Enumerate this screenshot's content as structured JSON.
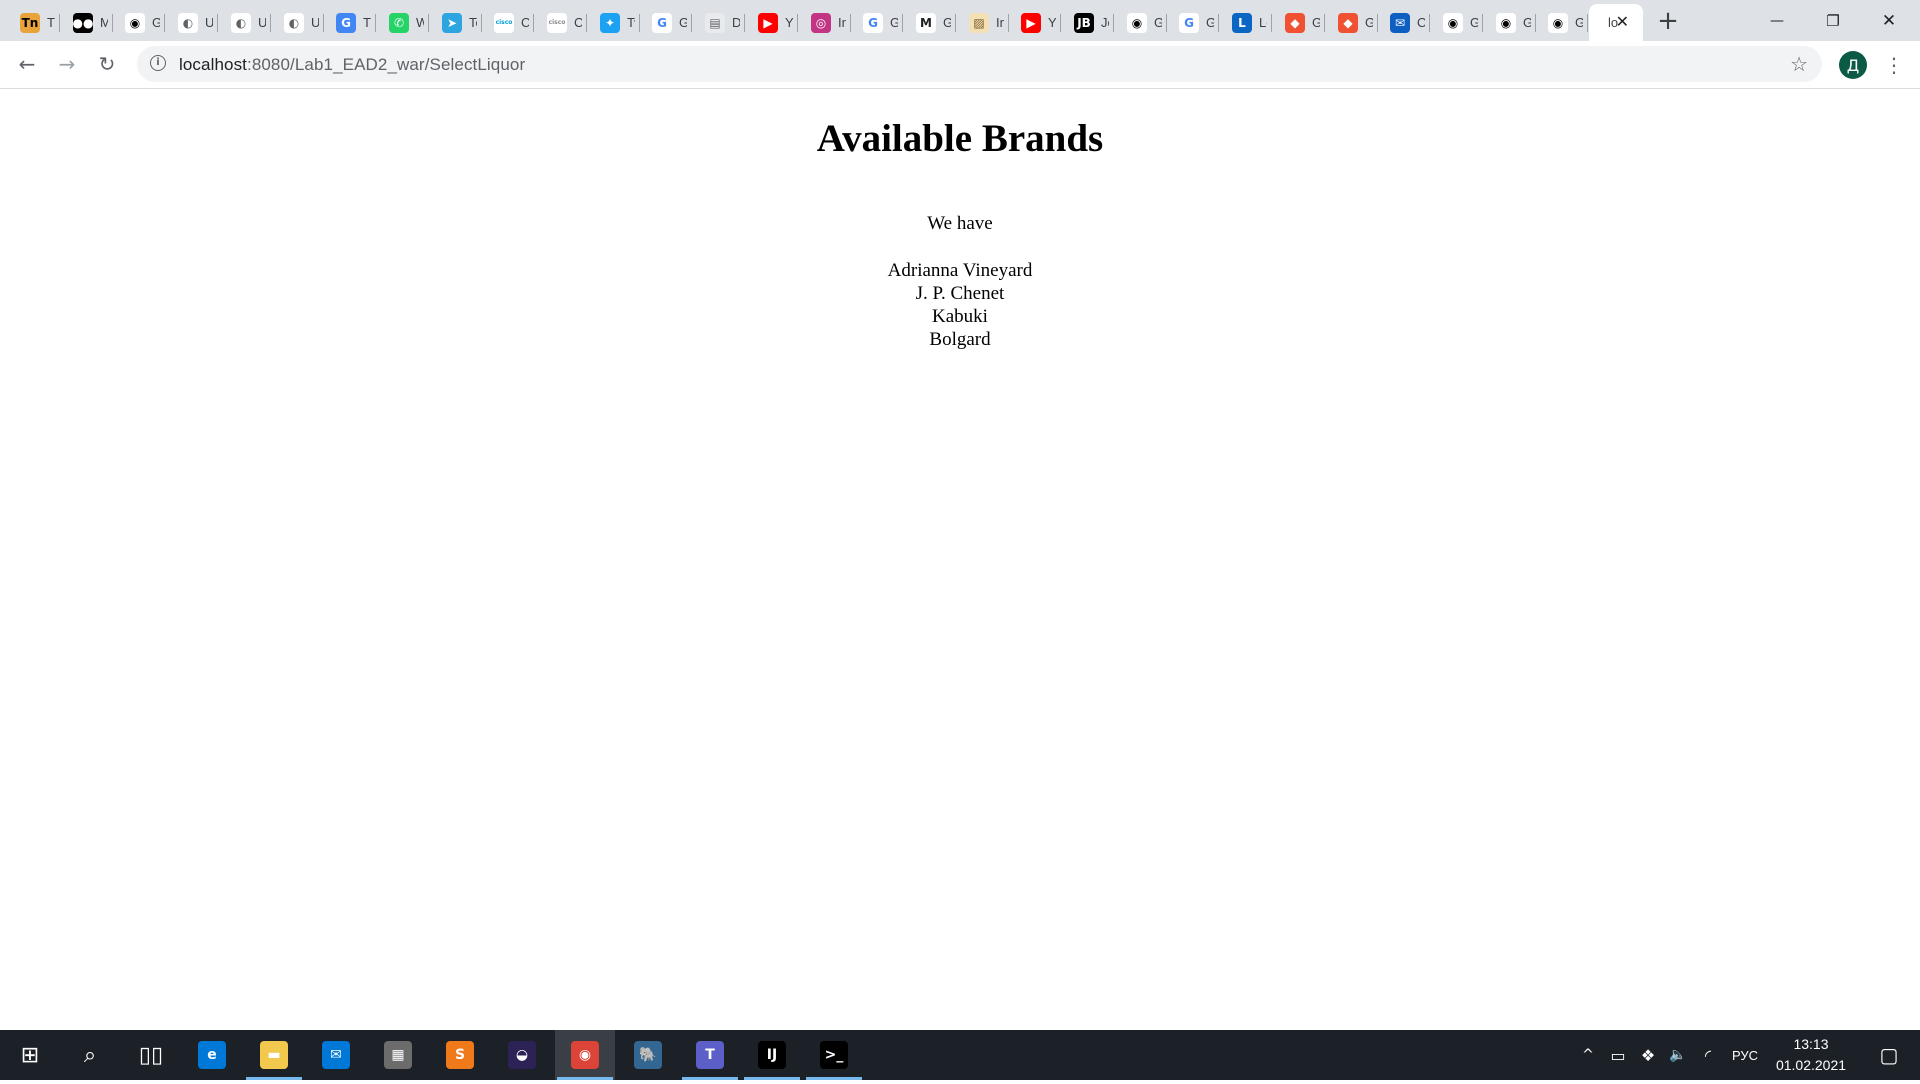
{
  "browser": {
    "tabs": [
      {
        "icon": "tn-icon",
        "title": "TN",
        "glyph": "Tn",
        "color": "#e8a33a",
        "text_color": "#000000"
      },
      {
        "icon": "medium-icon",
        "title": "Medium",
        "glyph": "●●",
        "color": "#000000",
        "text_color": "#ffffff"
      },
      {
        "icon": "github-icon",
        "title": "GitHub",
        "glyph": "◉",
        "color": "#ffffff",
        "text_color": "#000000"
      },
      {
        "icon": "globe-icon",
        "title": "Untitled",
        "glyph": "◐",
        "color": "#ffffff",
        "text_color": "#5f6368"
      },
      {
        "icon": "globe-icon",
        "title": "Untitled",
        "glyph": "◐",
        "color": "#ffffff",
        "text_color": "#5f6368"
      },
      {
        "icon": "globe-icon",
        "title": "Untitled",
        "glyph": "◐",
        "color": "#ffffff",
        "text_color": "#5f6368"
      },
      {
        "icon": "google-translate-icon",
        "title": "Translate",
        "glyph": "G",
        "color": "#4285f4",
        "text_color": "#ffffff"
      },
      {
        "icon": "whatsapp-icon",
        "title": "WhatsApp",
        "glyph": "✆",
        "color": "#25d366",
        "text_color": "#ffffff"
      },
      {
        "icon": "telegram-icon",
        "title": "Telegram",
        "glyph": "➤",
        "color": "#2ca5e0",
        "text_color": "#ffffff"
      },
      {
        "icon": "cisco-icon",
        "title": "Cisco",
        "glyph": "cisco",
        "color": "#ffffff",
        "text_color": "#049fd9"
      },
      {
        "icon": "cisco-icon",
        "title": "Cisco",
        "glyph": "cisco",
        "color": "#ffffff",
        "text_color": "#8a8a8a"
      },
      {
        "icon": "twitter-icon",
        "title": "Twitter",
        "glyph": "✦",
        "color": "#1da1f2",
        "text_color": "#ffffff"
      },
      {
        "icon": "google-icon",
        "title": "Google",
        "glyph": "G",
        "color": "#ffffff",
        "text_color": "#4285f4"
      },
      {
        "icon": "docs-icon",
        "title": "Docs",
        "glyph": "▤",
        "color": "#e8eaed",
        "text_color": "#5f6368"
      },
      {
        "icon": "youtube-icon",
        "title": "YouTube",
        "glyph": "▶",
        "color": "#ff0000",
        "text_color": "#ffffff"
      },
      {
        "icon": "instagram-icon",
        "title": "Instagram",
        "glyph": "◎",
        "color": "#c13584",
        "text_color": "#ffffff"
      },
      {
        "icon": "google-icon",
        "title": "Google",
        "glyph": "G",
        "color": "#ffffff",
        "text_color": "#4285f4"
      },
      {
        "icon": "gmail-icon",
        "title": "Gmail",
        "glyph": "M",
        "color": "#ffffff",
        "text_color": "#202124"
      },
      {
        "icon": "image-icon",
        "title": "Image",
        "glyph": "▨",
        "color": "#f3e0b5",
        "text_color": "#7a5a2a"
      },
      {
        "icon": "youtube-icon",
        "title": "YouTube",
        "glyph": "▶",
        "color": "#ff0000",
        "text_color": "#ffffff"
      },
      {
        "icon": "jetbrains-icon",
        "title": "JetBrains",
        "glyph": "JB",
        "color": "#000000",
        "text_color": "#ffffff"
      },
      {
        "icon": "github-icon",
        "title": "GitHub",
        "glyph": "◉",
        "color": "#ffffff",
        "text_color": "#000000"
      },
      {
        "icon": "google-icon",
        "title": "Google",
        "glyph": "G",
        "color": "#ffffff",
        "text_color": "#4285f4"
      },
      {
        "icon": "linkedin-learning-icon",
        "title": "Learning",
        "glyph": "L",
        "color": "#0a66c2",
        "text_color": "#ffffff"
      },
      {
        "icon": "git-icon",
        "title": "Git",
        "glyph": "◆",
        "color": "#f05133",
        "text_color": "#ffffff"
      },
      {
        "icon": "git-icon",
        "title": "Git",
        "glyph": "◆",
        "color": "#f05133",
        "text_color": "#ffffff"
      },
      {
        "icon": "outlook-icon",
        "title": "Outlook",
        "glyph": "✉",
        "color": "#0f5fc2",
        "text_color": "#ffffff"
      },
      {
        "icon": "github-icon",
        "title": "GitHub",
        "glyph": "◉",
        "color": "#ffffff",
        "text_color": "#000000"
      },
      {
        "icon": "github-icon",
        "title": "GitHub",
        "glyph": "◉",
        "color": "#ffffff",
        "text_color": "#000000"
      },
      {
        "icon": "github-icon",
        "title": "GitHub",
        "glyph": "◉",
        "color": "#ffffff",
        "text_color": "#000000"
      }
    ],
    "active_tab": {
      "title": "lo",
      "close_glyph": "✕"
    },
    "new_tab_glyph": "+",
    "window_controls": {
      "minimize": "—",
      "restore": "❐",
      "close": "✕"
    },
    "toolbar": {
      "back_glyph": "←",
      "forward_glyph": "→",
      "reload_glyph": "↻",
      "info_glyph": "i",
      "url_host": "localhost",
      "url_path": ":8080/Lab1_EAD2_war/SelectLiquor",
      "star_glyph": "☆",
      "profile_initial": "Д",
      "menu_glyph": "⋮"
    }
  },
  "page": {
    "heading": "Available Brands",
    "intro": "We have",
    "brands": [
      "Adrianna Vineyard",
      "J. P. Chenet",
      "Kabuki",
      "Bolgard"
    ]
  },
  "taskbar": {
    "pinned": [
      {
        "icon": "windows-start-icon",
        "glyph": "⊞",
        "color": "transparent",
        "running": false,
        "active": false
      },
      {
        "icon": "search-icon",
        "glyph": "⌕",
        "color": "transparent",
        "running": false,
        "active": false
      },
      {
        "icon": "task-view-icon",
        "glyph": "▯▯",
        "color": "transparent",
        "running": false,
        "active": false
      },
      {
        "icon": "edge-icon",
        "glyph": "e",
        "color": "#0078d7",
        "running": false,
        "active": false
      },
      {
        "icon": "file-explorer-icon",
        "glyph": "▬",
        "color": "#f2c94c",
        "running": true,
        "active": false
      },
      {
        "icon": "mail-icon",
        "glyph": "✉",
        "color": "#0078d7",
        "running": false,
        "active": false
      },
      {
        "icon": "store-icon",
        "glyph": "▦",
        "color": "#6c6c6c",
        "running": false,
        "active": false
      },
      {
        "icon": "sublime-text-icon",
        "glyph": "S",
        "color": "#f07a1a",
        "running": false,
        "active": false
      },
      {
        "icon": "eclipse-icon",
        "glyph": "◒",
        "color": "#2c2255",
        "running": false,
        "active": false
      },
      {
        "icon": "chrome-icon",
        "glyph": "◉",
        "color": "#db4437",
        "running": true,
        "active": true
      },
      {
        "icon": "postgresql-icon",
        "glyph": "🐘",
        "color": "#336791",
        "running": false,
        "active": false
      },
      {
        "icon": "teams-icon",
        "glyph": "T",
        "color": "#5b5fc7",
        "running": true,
        "active": false
      },
      {
        "icon": "intellij-icon",
        "glyph": "IJ",
        "color": "#000000",
        "running": true,
        "active": false
      },
      {
        "icon": "terminal-icon",
        "glyph": ">_",
        "color": "#000000",
        "running": true,
        "active": false
      }
    ],
    "tray": {
      "chevron_glyph": "^",
      "battery_glyph": "▭",
      "dropbox_glyph": "❖",
      "volume_glyph": "🔈",
      "wifi_glyph": "◜",
      "language": "РУС",
      "time": "13:13",
      "date": "01.02.2021",
      "notification_glyph": "▢"
    }
  }
}
